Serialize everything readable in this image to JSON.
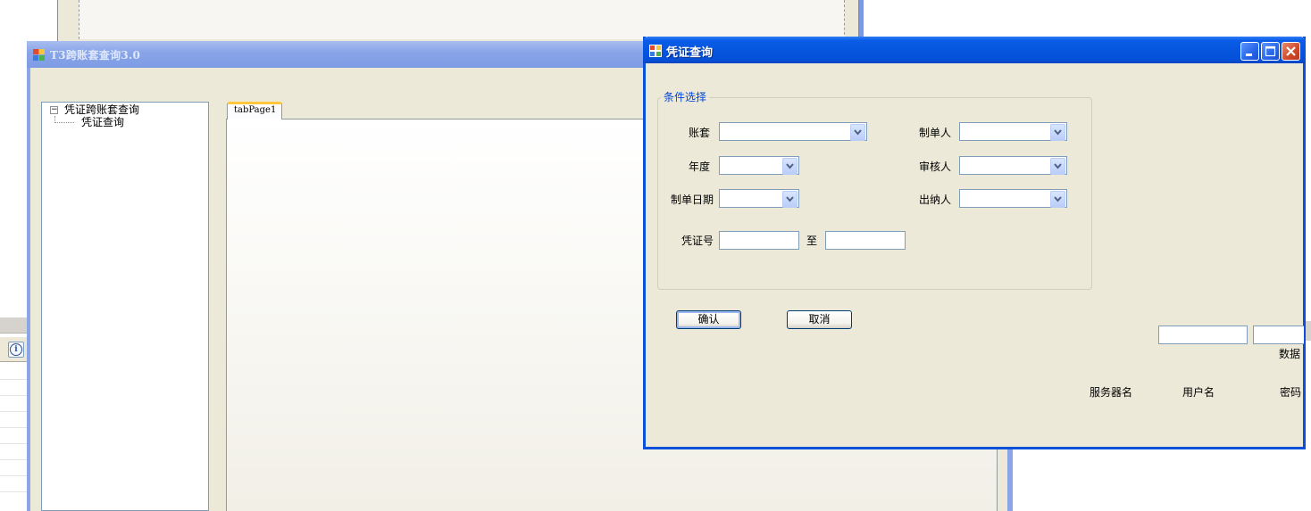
{
  "main_window": {
    "title": "T3跨账套查询3.0",
    "tree": {
      "root_label": "凭证跨账套查询",
      "root_expander": "−",
      "child_label": "凭证查询"
    },
    "tab_label": "tabPage1"
  },
  "dialog": {
    "title": "凭证查询",
    "group_title": "条件选择",
    "labels": {
      "account_set": "账套",
      "year": "年度",
      "voucher_date": "制单日期",
      "voucher_no": "凭证号",
      "to": "至",
      "preparer": "制单人",
      "auditor": "审核人",
      "cashier": "出纳人"
    },
    "values": {
      "account_set": "",
      "year": "",
      "voucher_date": "",
      "voucher_no_from": "",
      "voucher_no_to": "",
      "preparer": "",
      "auditor": "",
      "cashier": ""
    },
    "buttons": {
      "confirm": "确认",
      "cancel": "取消"
    },
    "connection": {
      "server_label": "服务器名",
      "user_label": "用户名",
      "password_label": "密码",
      "database_label": "数据",
      "server_value": "",
      "user_value": ""
    }
  },
  "colors": {
    "dialog_title": "#0656df",
    "main_title_inactive": "#8aa6e9",
    "window_face": "#ece9d8",
    "group_legend": "#0046d5"
  },
  "icons": [
    "app-icon",
    "minimize-icon",
    "maximize-icon",
    "close-icon",
    "chevron-down-icon",
    "info-icon"
  ]
}
